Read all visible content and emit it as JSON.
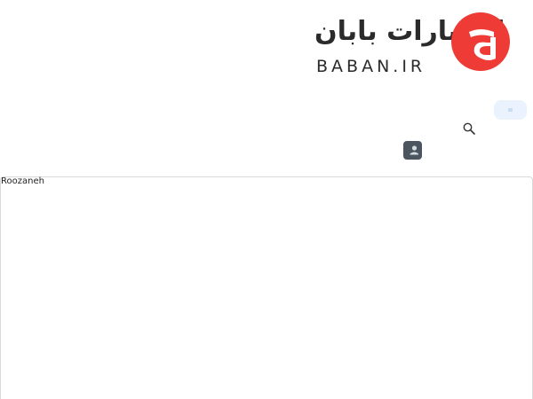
{
  "header": {
    "logo": {
      "title_fa": "انتشارات بابان",
      "title_en": "BABAN.IR"
    },
    "colors": {
      "brand": "#ee3b35",
      "text_dark": "#2b2b2b",
      "pill": "#eaf3fd",
      "account": "#4a5560"
    },
    "icons": {
      "search": "search-icon",
      "account": "user-icon",
      "menu": "menu-icon"
    }
  },
  "content": {
    "frame_title": "Roozaneh"
  }
}
